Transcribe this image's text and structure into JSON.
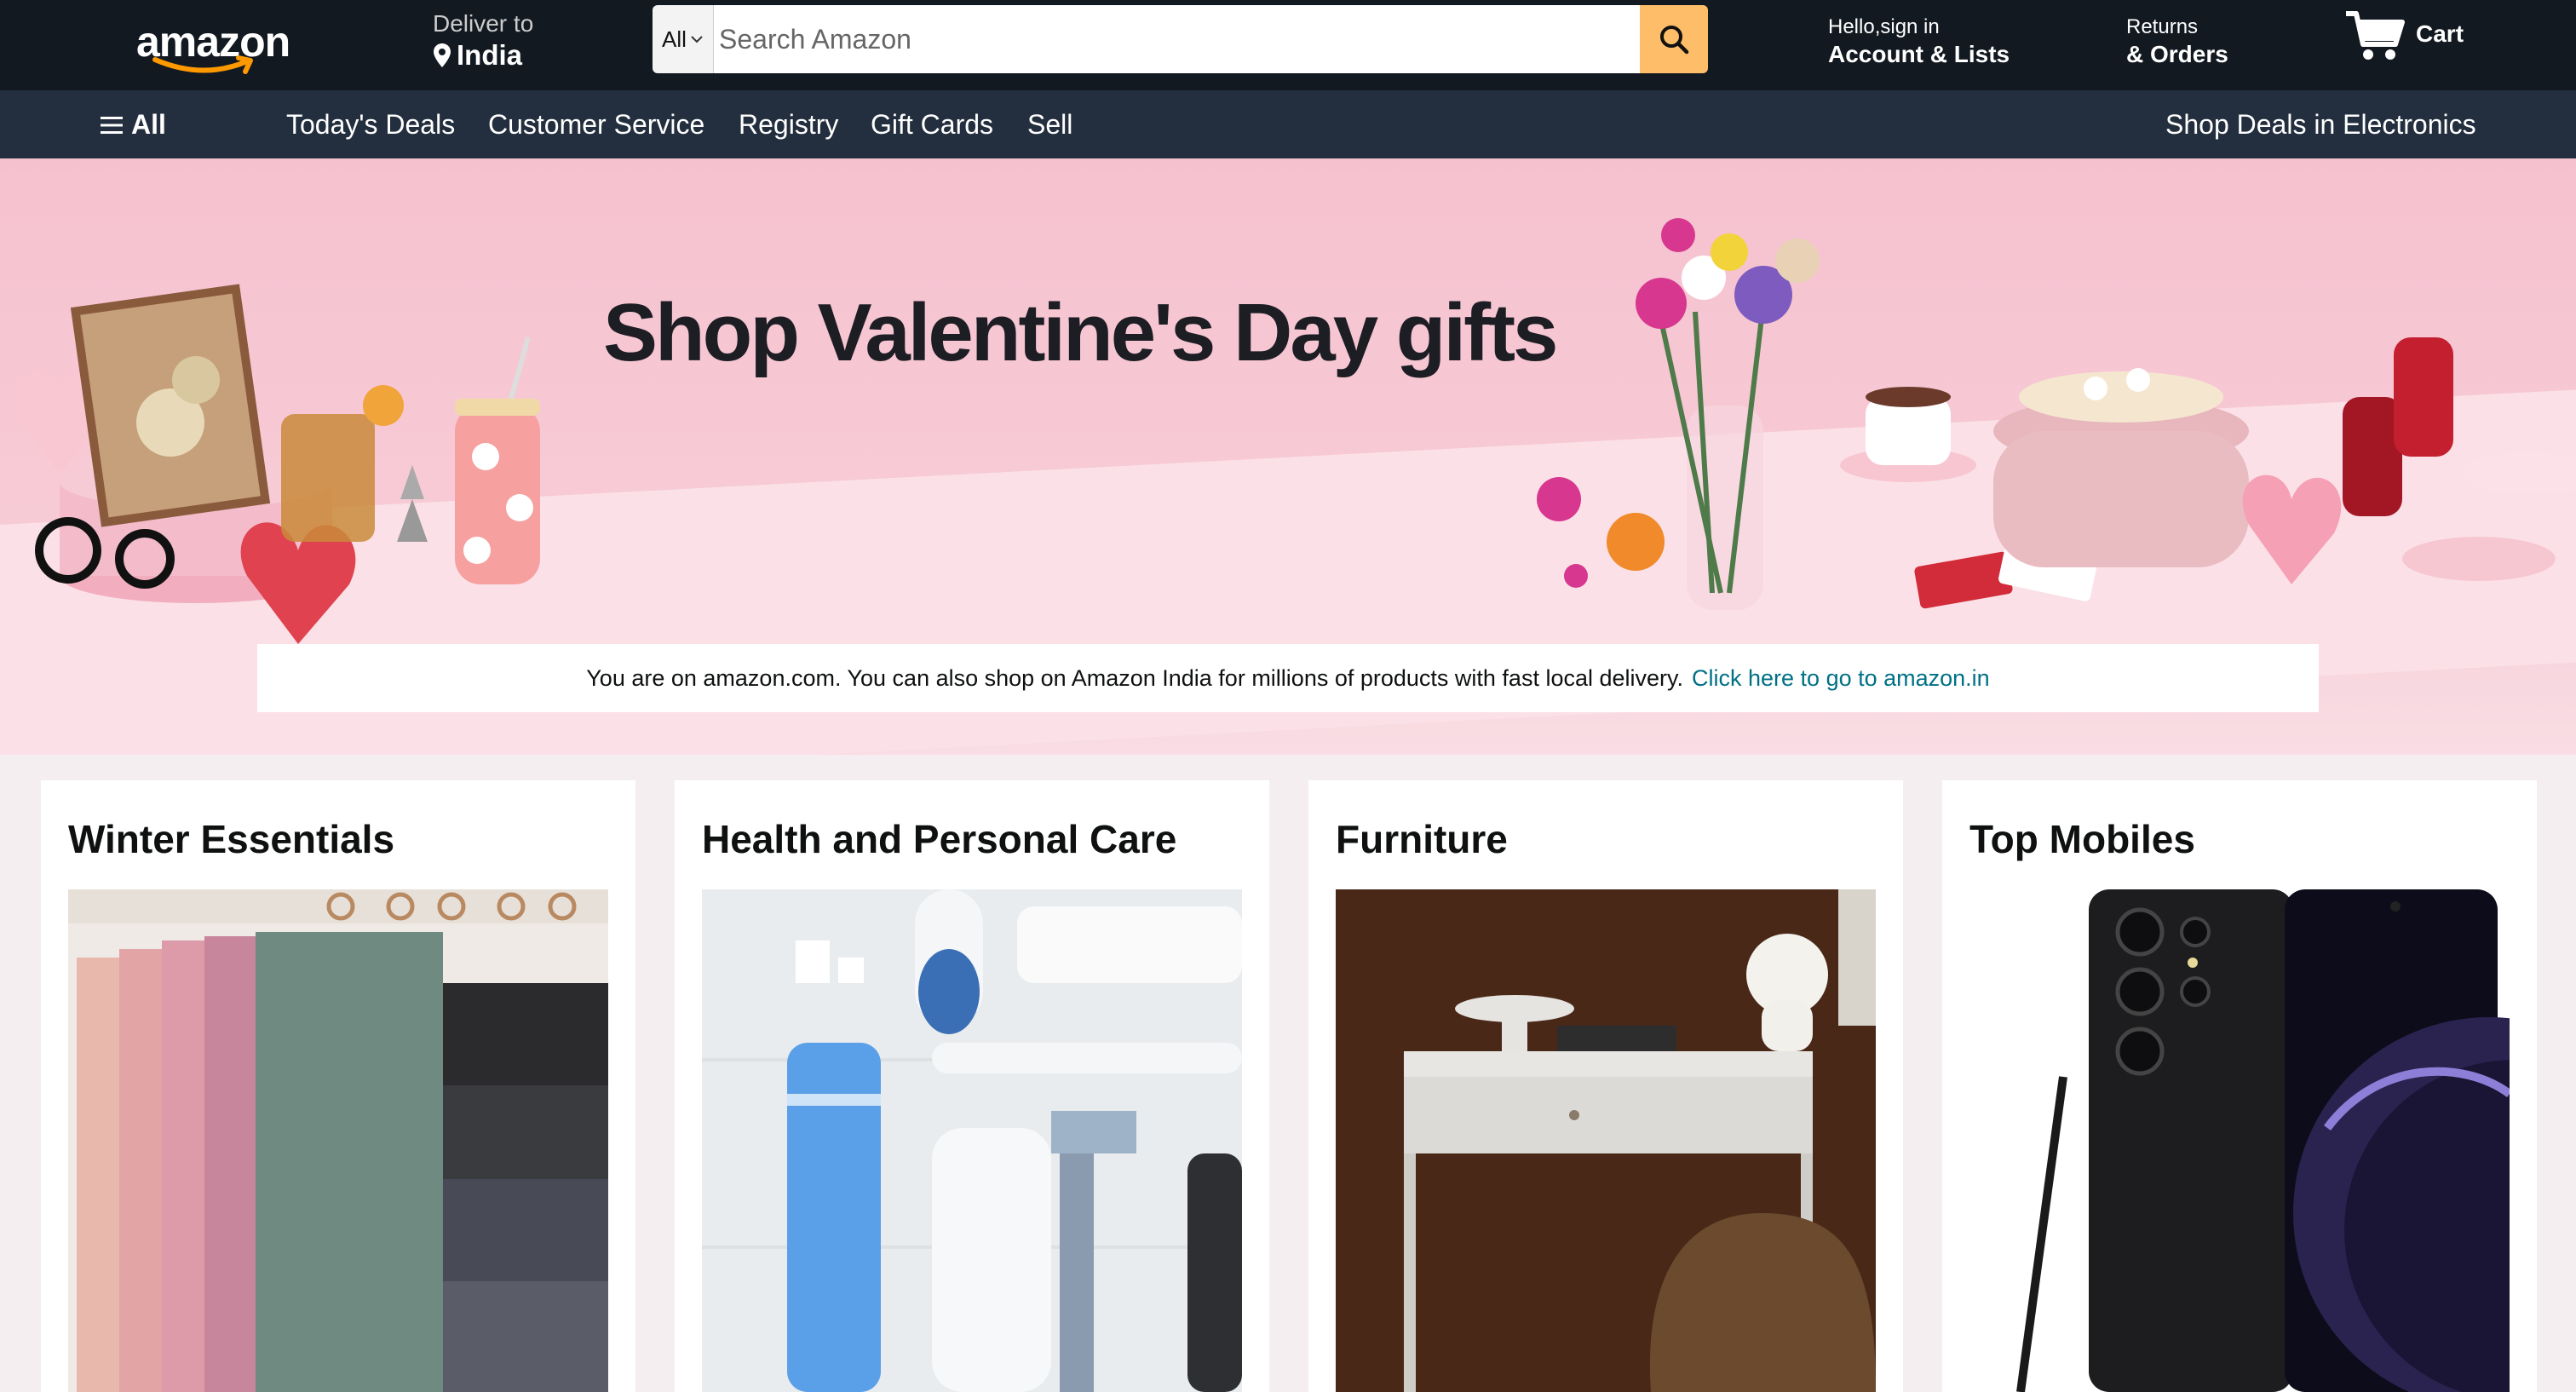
{
  "header": {
    "logo_text": "amazon",
    "deliver_label": "Deliver to",
    "deliver_location": "India",
    "search_category": "All",
    "search_placeholder": "Search Amazon",
    "account_greeting": "Hello,sign in",
    "account_label": "Account & Lists",
    "returns_top": "Returns",
    "returns_bottom": "& Orders",
    "cart_label": "Cart"
  },
  "subnav": {
    "all_label": "All",
    "items": [
      "Today's Deals",
      "Customer Service",
      "Registry",
      "Gift Cards",
      "Sell"
    ],
    "right_label": "Shop Deals in Electronics"
  },
  "hero": {
    "title": "Shop Valentine's Day gifts",
    "notice_text": "You are on amazon.com. You can also shop on Amazon India for millions of products with fast local delivery.",
    "notice_link": "Click here to go to amazon.in"
  },
  "cards": [
    {
      "title": "Winter Essentials"
    },
    {
      "title": "Health and Personal Care"
    },
    {
      "title": "Furniture"
    },
    {
      "title": "Top Mobiles"
    }
  ],
  "colors": {
    "nav_bg": "#131921",
    "subnav_bg": "#232f3e",
    "search_button": "#febd69",
    "link": "#007185",
    "hero_bg": "#f6c1cf"
  }
}
